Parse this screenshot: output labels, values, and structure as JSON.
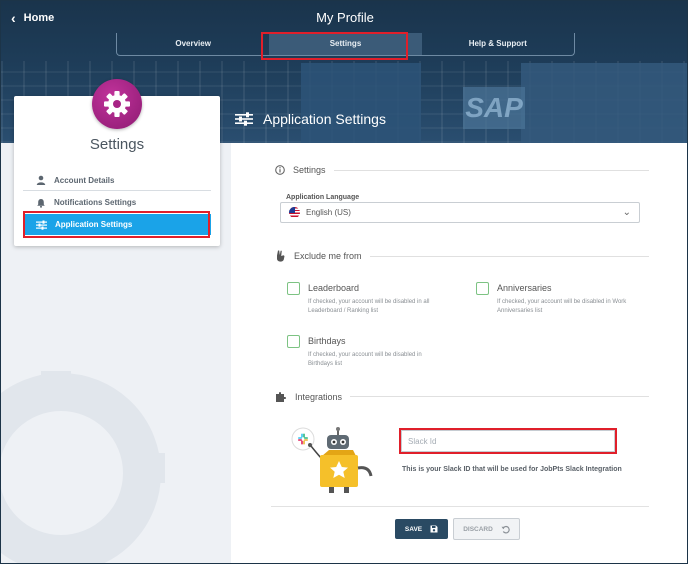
{
  "header": {
    "home_label": "Home",
    "title": "My Profile",
    "tabs": [
      {
        "label": "Overview"
      },
      {
        "label": "Settings",
        "active": true
      },
      {
        "label": "Help & Support"
      }
    ]
  },
  "sidebar": {
    "title": "Settings",
    "items": [
      {
        "label": "Account Details",
        "icon": "user-icon"
      },
      {
        "label": "Notifications Settings",
        "icon": "bell-icon"
      },
      {
        "label": "Application Settings",
        "icon": "sliders-icon",
        "active": true
      }
    ]
  },
  "main": {
    "heading": "Application Settings",
    "settings_section": {
      "label": "Settings",
      "language_label": "Application Language",
      "language_value": "English (US)"
    },
    "exclude_section": {
      "label": "Exclude me from",
      "options": [
        {
          "title": "Leaderboard",
          "desc": "If checked, your account will be disabled in all Leaderboard / Ranking list",
          "checked": false
        },
        {
          "title": "Anniversaries",
          "desc": "If checked, your account will be disabled in Work Anniversaries list",
          "checked": false
        },
        {
          "title": "Birthdays",
          "desc": "If checked, your account will be disabled in Birthdays list",
          "checked": false
        }
      ]
    },
    "integrations_section": {
      "label": "Integrations",
      "slack_placeholder": "Slack Id",
      "slack_note": "This is your Slack ID that will be used for JobPts Slack Integration"
    },
    "buttons": {
      "save": "SAVE",
      "discard": "DISCARD"
    }
  },
  "colors": {
    "header_bg": "#1e3d59",
    "accent_blue": "#1aa3e8",
    "badge_magenta": "#a72385",
    "checkbox_green": "#7dc383",
    "highlight_red": "#e01f2a",
    "save_button": "#2a4a63"
  }
}
